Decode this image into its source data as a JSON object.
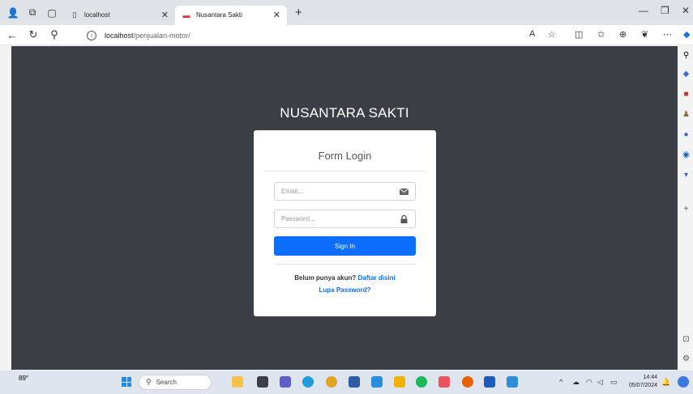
{
  "browser": {
    "tabs": [
      {
        "label": "localhost",
        "active": false
      },
      {
        "label": "Nusantara Sakti",
        "active": true
      }
    ],
    "url": {
      "host": "localhost",
      "path": "/penjualan-motor/"
    }
  },
  "page": {
    "brand": "NUSANTARA SAKTI",
    "form_title": "Form Login",
    "email_placeholder": "Email...",
    "password_placeholder": "Password...",
    "signin_label": "Sign In",
    "register_prompt": "Belum punya akun?",
    "register_link": "Daftar disini",
    "forgot_link": "Lupa Password?"
  },
  "taskbar": {
    "weather": "89°",
    "search_label": "Search",
    "time": "14:44",
    "date": "05/07/2024"
  },
  "colors": {
    "page_bg": "#3b3f45",
    "primary": "#0d6efd"
  }
}
